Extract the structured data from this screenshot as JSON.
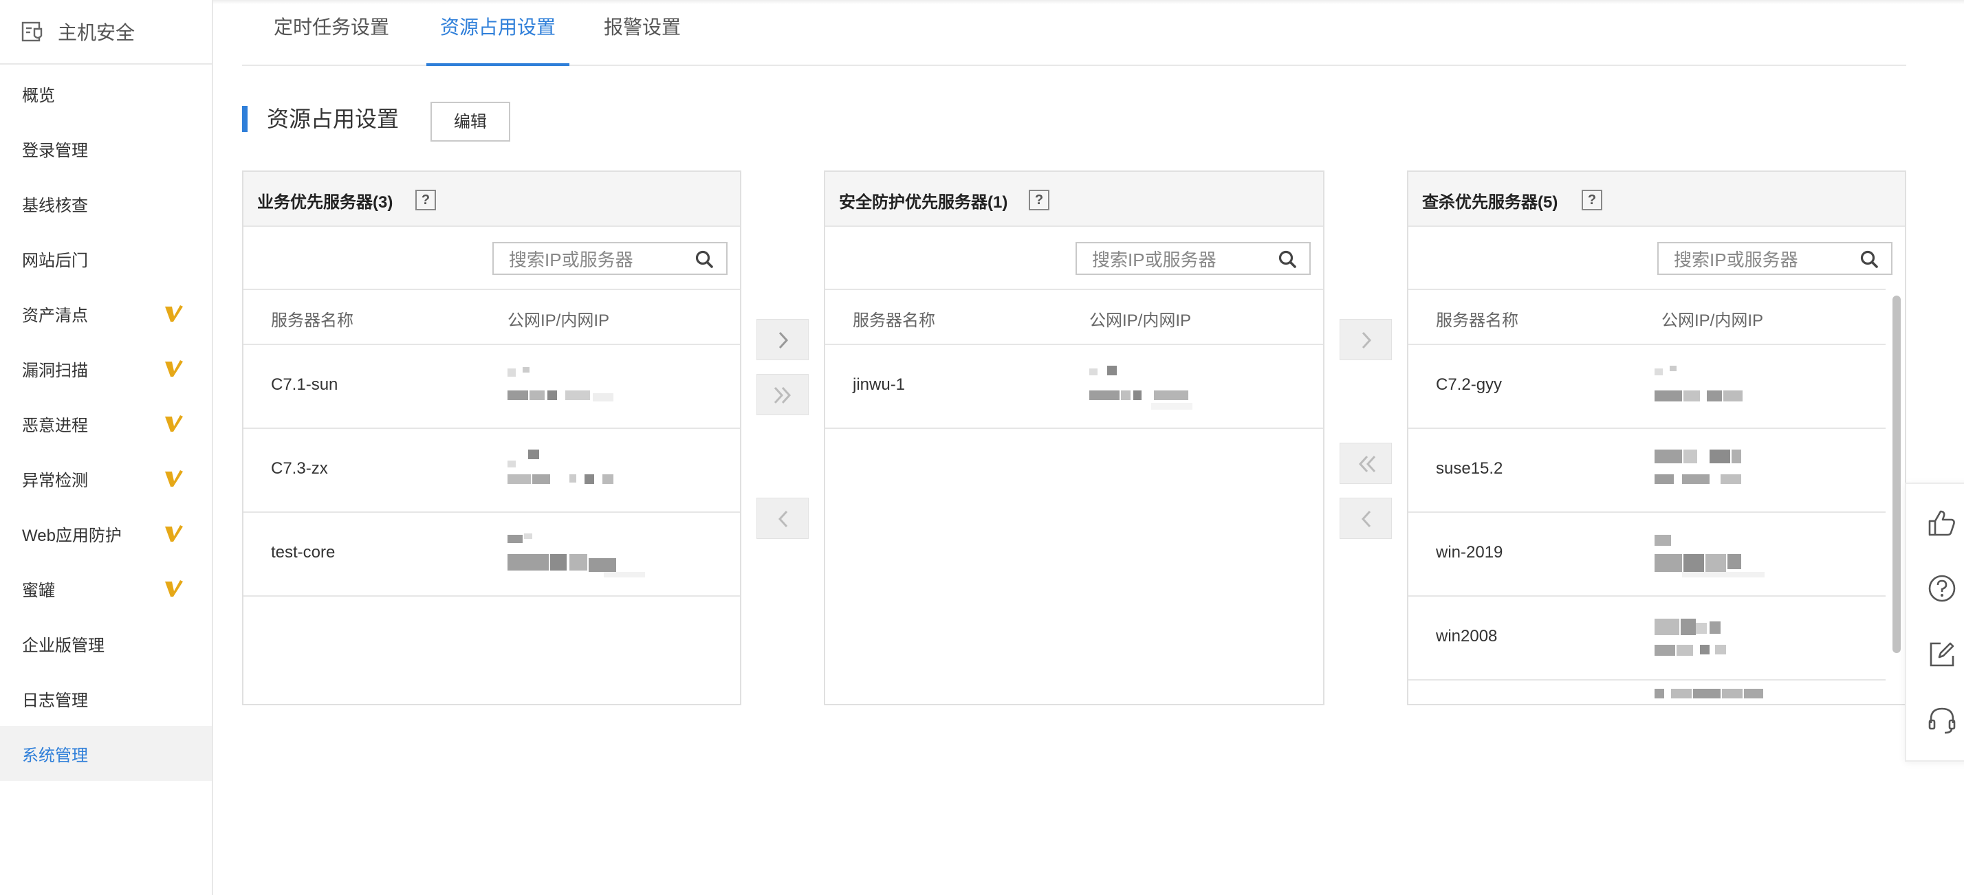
{
  "sidebar": {
    "title": "主机安全",
    "items": [
      {
        "label": "概览",
        "vip": false
      },
      {
        "label": "登录管理",
        "vip": false
      },
      {
        "label": "基线核查",
        "vip": false
      },
      {
        "label": "网站后门",
        "vip": false
      },
      {
        "label": "资产清点",
        "vip": true
      },
      {
        "label": "漏洞扫描",
        "vip": true
      },
      {
        "label": "恶意进程",
        "vip": true
      },
      {
        "label": "异常检测",
        "vip": true
      },
      {
        "label": "Web应用防护",
        "vip": true
      },
      {
        "label": "蜜罐",
        "vip": true
      },
      {
        "label": "企业版管理",
        "vip": false
      },
      {
        "label": "日志管理",
        "vip": false
      },
      {
        "label": "系统管理",
        "vip": false,
        "active": true
      }
    ]
  },
  "tabs": [
    {
      "label": "定时任务设置",
      "active": false
    },
    {
      "label": "资源占用设置",
      "active": true
    },
    {
      "label": "报警设置",
      "active": false
    }
  ],
  "section": {
    "title": "资源占用设置",
    "edit_label": "编辑"
  },
  "columns": {
    "name": "服务器名称",
    "ip": "公网IP/内网IP"
  },
  "search_placeholder": "搜索IP或服务器",
  "panels": [
    {
      "title": "业务优先服务器(3)",
      "rows": [
        {
          "name": "C7.1-sun"
        },
        {
          "name": "C7.3-zx"
        },
        {
          "name": "test-core"
        }
      ]
    },
    {
      "title": "安全防护优先服务器(1)",
      "rows": [
        {
          "name": "jinwu-1"
        }
      ]
    },
    {
      "title": "查杀优先服务器(5)",
      "rows": [
        {
          "name": "C7.2-gyy"
        },
        {
          "name": "suse15.2"
        },
        {
          "name": "win-2019"
        },
        {
          "name": "win2008"
        },
        {
          "name": ""
        }
      ]
    }
  ],
  "help_label": "?",
  "colors": {
    "accent": "#2f7fd9",
    "vip": "#e6a817"
  },
  "icons": {
    "float_bar": [
      "thumbs-up-icon",
      "question-circle-icon",
      "edit-icon",
      "headset-icon"
    ],
    "transfer": [
      "chevron-right-icon",
      "double-chevron-right-icon",
      "chevron-left-icon",
      "double-chevron-left-icon"
    ]
  }
}
